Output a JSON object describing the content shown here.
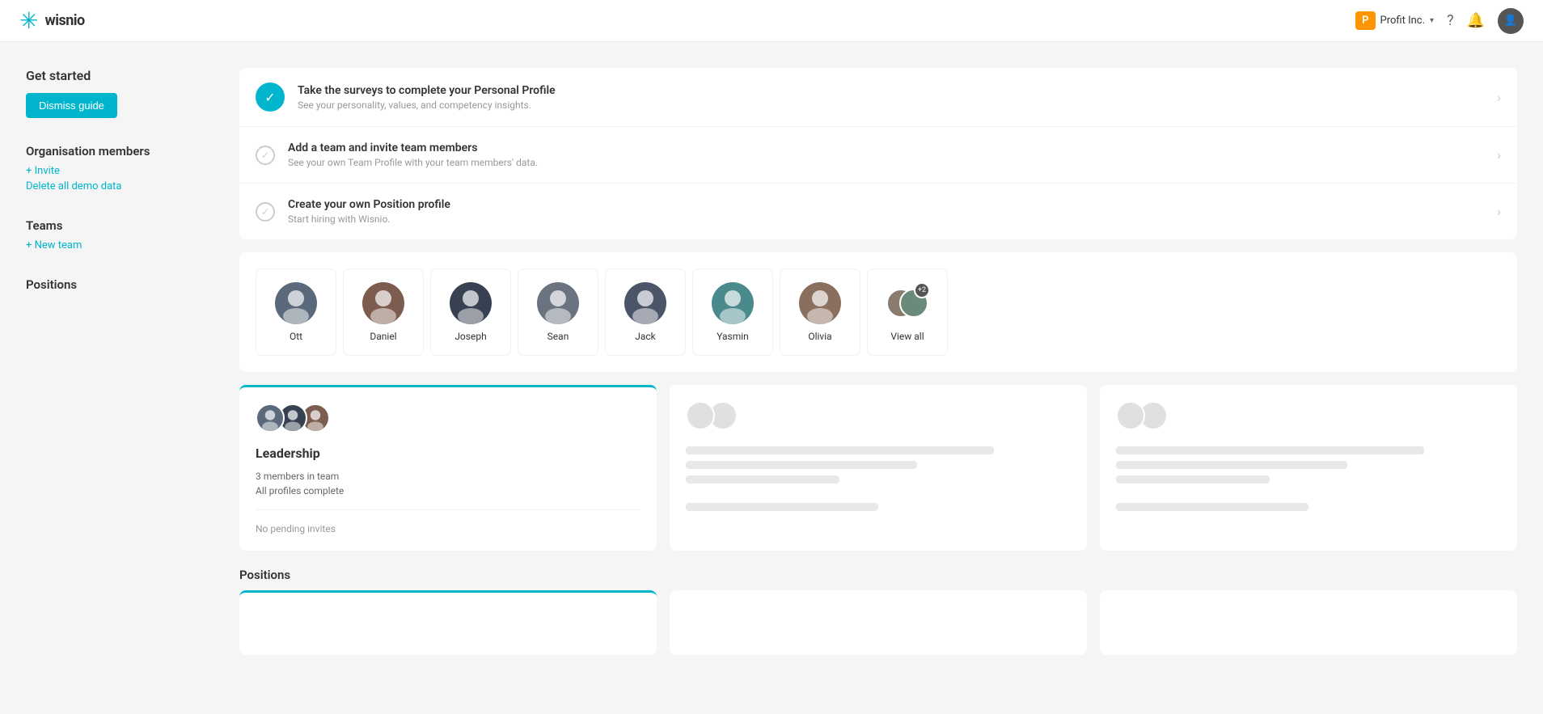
{
  "header": {
    "logo_text": "wisnio",
    "company_initial": "P",
    "company_name": "Profit Inc.",
    "company_dropdown": "▾"
  },
  "sidebar": {
    "get_started_title": "Get started",
    "dismiss_btn": "Dismiss guide",
    "org_members_title": "Organisation members",
    "invite_link": "+ Invite",
    "delete_link": "Delete all demo data",
    "teams_title": "Teams",
    "new_team_link": "+ New team",
    "positions_title": "Positions"
  },
  "get_started_items": [
    {
      "title": "Take the surveys to complete your Personal Profile",
      "subtitle": "See your personality, values, and competency insights.",
      "completed": true
    },
    {
      "title": "Add a team and invite team members",
      "subtitle": "See your own Team Profile with your team members' data.",
      "completed": false
    },
    {
      "title": "Create your own Position profile",
      "subtitle": "Start hiring with Wisnio.",
      "completed": false
    }
  ],
  "members": [
    {
      "name": "Ott",
      "color": "#5a6a7a"
    },
    {
      "name": "Daniel",
      "color": "#7c5c4e"
    },
    {
      "name": "Joseph",
      "color": "#374151"
    },
    {
      "name": "Sean",
      "color": "#6b7280"
    },
    {
      "name": "Jack",
      "color": "#4a5568"
    },
    {
      "name": "Yasmin",
      "color": "#4a8a8c"
    },
    {
      "name": "Olivia",
      "color": "#8b6f5e"
    }
  ],
  "view_all_label": "View all",
  "view_all_plus": "+2",
  "teams": [
    {
      "name": "Leadership",
      "members_count": "3 members in team",
      "profiles_status": "All profiles complete",
      "pending_invites": "No pending invites"
    }
  ],
  "sections": {
    "teams_label": "Teams",
    "positions_label": "Positions"
  }
}
